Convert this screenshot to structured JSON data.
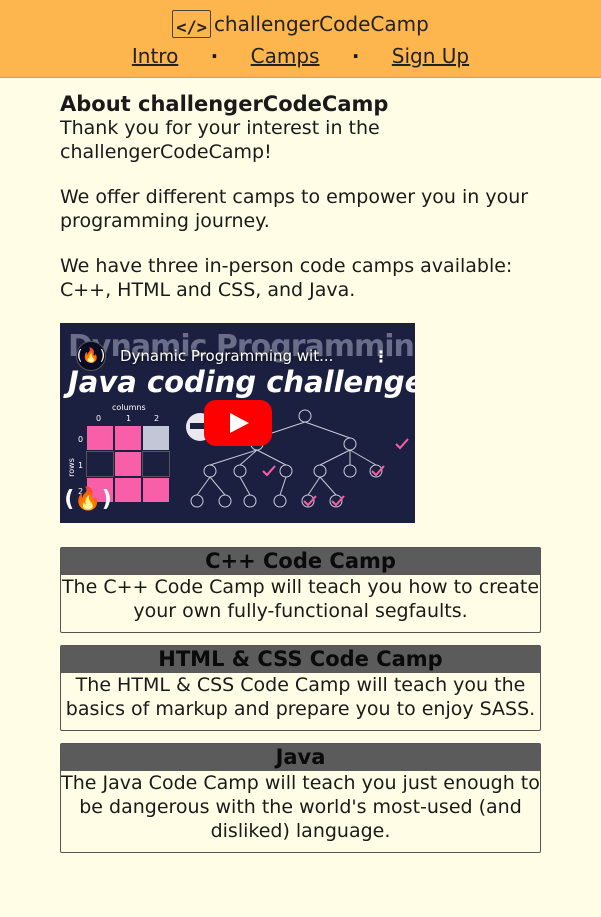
{
  "header": {
    "logo_text": "</>",
    "brand": "challengerCodeCamp",
    "nav": [
      "Intro",
      "Camps",
      "Sign Up"
    ],
    "separator": "·",
    "background": "#fdb54e"
  },
  "about": {
    "title": "About challengerCodeCamp",
    "paragraphs": [
      "Thank you for your interest in the challengerCodeCamp!",
      "We offer different camps to empower you in your programming journey.",
      "We have three in-person code camps available: C++, HTML and CSS, and Java."
    ]
  },
  "video": {
    "thumbnail_heading": "Dynamic Programming",
    "thumbnail_subheading": "Java coding challenges!",
    "title": "Dynamic Programming wit...",
    "grid_header": "columns",
    "grid_rows_label": "rows",
    "column_numbers": [
      "0",
      "1",
      "2"
    ],
    "row_numbers": [
      "0",
      "1",
      "2"
    ],
    "channel_icon": "freecodecamp-icon",
    "play_icon": "youtube-play-icon",
    "menu_icon": "kebab-menu-icon"
  },
  "camps": [
    {
      "title": "C++ Code Camp",
      "description": "The C++ Code Camp will teach you how to create your own fully-functional segfaults."
    },
    {
      "title": "HTML & CSS Code Camp",
      "description": "The HTML & CSS Code Camp will teach you the basics of markup and prepare you to enjoy SASS."
    },
    {
      "title": "Java",
      "description": "The Java Code Camp will teach you just enough to be dangerous with the world's most-used (and disliked) language."
    }
  ]
}
